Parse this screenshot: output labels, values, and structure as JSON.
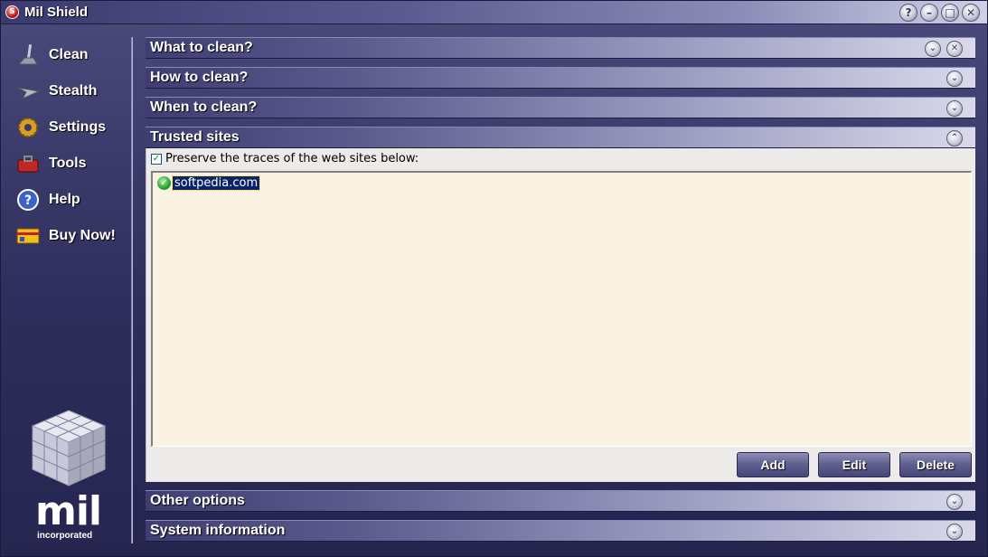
{
  "window": {
    "title": "Mil Shield",
    "app_icon": "shield-app-icon",
    "controls": [
      {
        "name": "help-window-button",
        "glyph": "?"
      },
      {
        "name": "minimize-window-button",
        "glyph": "–"
      },
      {
        "name": "maximize-window-button",
        "glyph": "□"
      },
      {
        "name": "close-window-button",
        "glyph": "✕"
      }
    ]
  },
  "sidebar": {
    "items": [
      {
        "label": "Clean",
        "icon": "broom-icon"
      },
      {
        "label": "Stealth",
        "icon": "stealth-plane-icon"
      },
      {
        "label": "Settings",
        "icon": "gear-icon"
      },
      {
        "label": "Tools",
        "icon": "toolbox-icon"
      },
      {
        "label": "Help",
        "icon": "question-icon"
      },
      {
        "label": "Buy Now!",
        "icon": "credit-card-icon"
      }
    ],
    "logo": {
      "text": "mil",
      "subtext": "incorporated"
    }
  },
  "sections": {
    "what_to_clean": {
      "title": "What to clean?",
      "state": "collapsed"
    },
    "how_to_clean": {
      "title": "How to clean?",
      "state": "collapsed"
    },
    "when_to_clean": {
      "title": "When to clean?",
      "state": "collapsed"
    },
    "trusted_sites": {
      "title": "Trusted sites",
      "state": "expanded"
    },
    "other_options": {
      "title": "Other options",
      "state": "collapsed"
    },
    "system_information": {
      "title": "System information",
      "state": "collapsed"
    }
  },
  "trusted_sites_panel": {
    "preserve_label": "Preserve the traces of the web sites below:",
    "preserve_checked": true,
    "sites": [
      "softpedia.com"
    ],
    "buttons": {
      "add": "Add",
      "edit": "Edit",
      "delete": "Delete"
    }
  },
  "glyphs": {
    "expand": "⌄",
    "collapse": "⌃",
    "close": "✕"
  },
  "colors": {
    "selection": "#0a246a",
    "list_background": "#faf2e2",
    "site_ok": "#2aa02a"
  }
}
